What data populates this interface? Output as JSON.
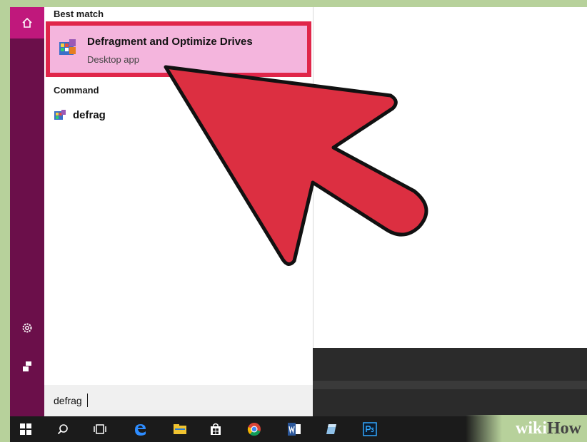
{
  "sections": {
    "best_match": "Best match",
    "command": "Command"
  },
  "best_result": {
    "title": "Defragment and Optimize Drives",
    "subtitle": "Desktop app"
  },
  "command_result": {
    "label": "defrag"
  },
  "search": {
    "query": "defrag"
  },
  "watermark": {
    "part1": "wiki",
    "part2": "How"
  },
  "colors": {
    "rail": "#6b0f4a",
    "home_tile": "#c0187c",
    "highlight": "#f4b5dd",
    "highlight_border": "#e0264a",
    "arrow": "#dc2f41"
  }
}
